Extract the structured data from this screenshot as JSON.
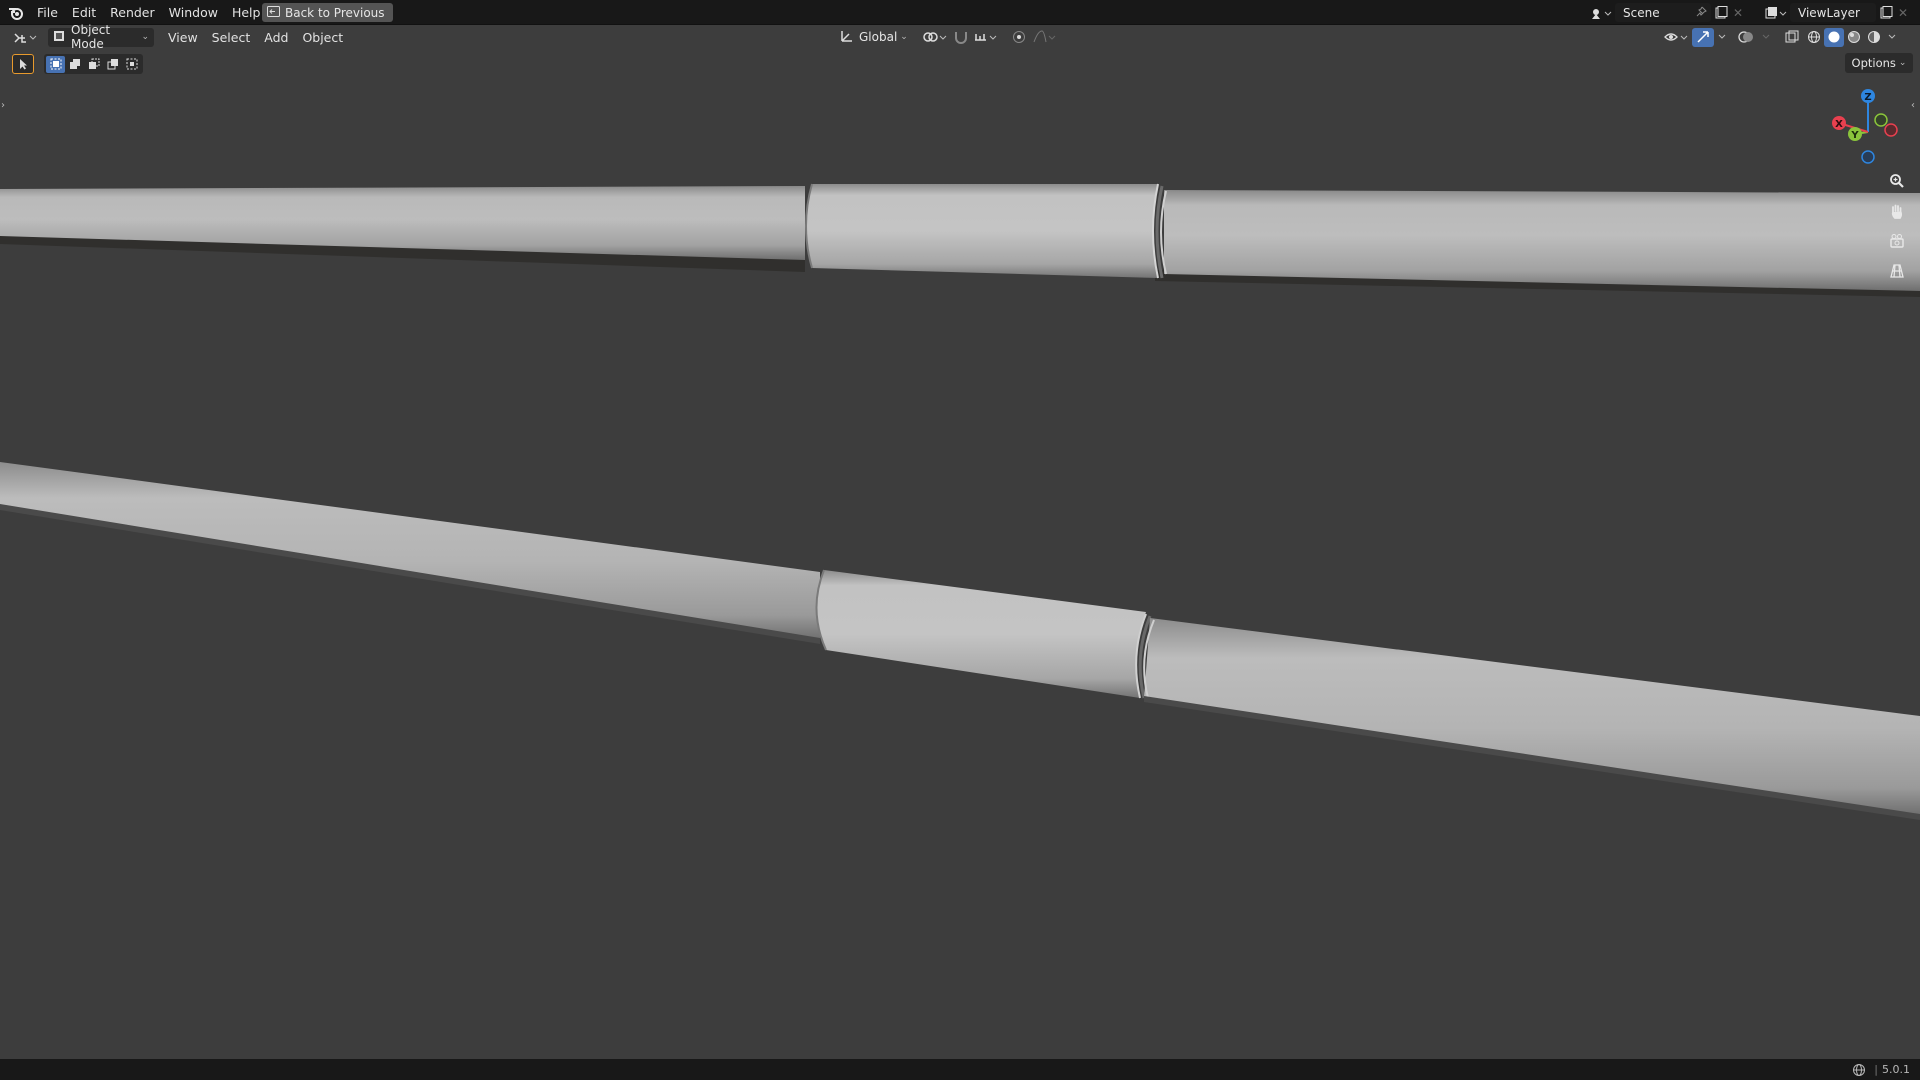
{
  "menubar": {
    "items": [
      "File",
      "Edit",
      "Render",
      "Window",
      "Help"
    ],
    "back_button": "Back to Previous",
    "scene": "Scene",
    "view_layer": "ViewLayer"
  },
  "viewport_header": {
    "mode": "Object Mode",
    "menus": [
      "View",
      "Select",
      "Add",
      "Object"
    ],
    "transform_orientation": "Global",
    "options_label": "Options"
  },
  "gizmo": {
    "axes": {
      "x": "X",
      "y": "Y",
      "z": "Z"
    },
    "colors": {
      "x": "#e8404f",
      "y": "#8ac43b",
      "z": "#2e86e0"
    }
  },
  "statusbar": {
    "version": "5.0.1"
  },
  "colors": {
    "background": "#3d3d3d",
    "topbar": "#181818",
    "accent_blue": "#4772b3",
    "active_orange": "#e89a2d"
  }
}
